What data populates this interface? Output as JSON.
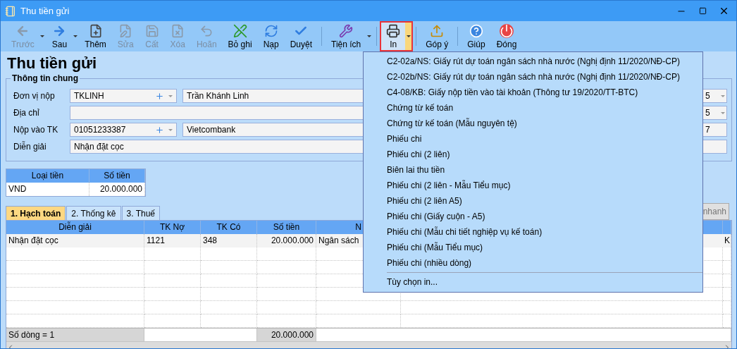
{
  "window": {
    "title": "Thu tiền gửi"
  },
  "toolbar": [
    [
      {
        "label": "Trước",
        "disabled": true,
        "has_menu": true,
        "open": false
      },
      {
        "label": "Sau",
        "disabled": false,
        "has_menu": true,
        "open": false
      },
      {
        "label": "Thêm",
        "disabled": false,
        "has_menu": false,
        "open": false
      },
      {
        "label": "Sửa",
        "disabled": true,
        "has_menu": false,
        "open": false
      },
      {
        "label": "Cất",
        "disabled": true,
        "has_menu": false,
        "open": false
      },
      {
        "label": "Xóa",
        "disabled": true,
        "has_menu": false,
        "open": false
      },
      {
        "label": "Hoãn",
        "disabled": true,
        "has_menu": false,
        "open": false
      },
      {
        "label": "Bỏ ghi",
        "disabled": false,
        "has_menu": false,
        "open": false
      },
      {
        "label": "Nạp",
        "disabled": false,
        "has_menu": false,
        "open": false
      },
      {
        "label": "Duyệt",
        "disabled": false,
        "has_menu": false,
        "open": false
      }
    ],
    [
      {
        "label": "Tiện ích",
        "disabled": false,
        "has_menu": true,
        "open": false
      }
    ],
    [
      {
        "label": "In",
        "disabled": false,
        "has_menu": true,
        "open": true
      }
    ],
    [
      {
        "label": "Góp ý",
        "disabled": false,
        "has_menu": false,
        "open": false
      }
    ],
    [
      {
        "label": "Giúp",
        "disabled": false,
        "has_menu": false,
        "open": false
      },
      {
        "label": "Đóng",
        "disabled": false,
        "has_menu": false,
        "open": false
      }
    ]
  ],
  "heading": "Thu tiền gửi",
  "general_info": {
    "title": "Thông tin chung",
    "fields": [
      {
        "label": "Đơn vị nộp",
        "kind": "lookup",
        "code": "TKLINH",
        "name": "Trần Khánh Linh"
      },
      {
        "label": "Địa chỉ",
        "kind": "text"
      },
      {
        "label": "Nộp vào TK",
        "kind": "lookup",
        "code": "01051233387",
        "name": "Vietcombank"
      },
      {
        "label": "Diễn giải",
        "kind": "text",
        "value": "Nhận đặt cọc"
      }
    ],
    "right_fields": [
      {
        "kind": "combo",
        "value": "5"
      },
      {
        "kind": "combo",
        "value": "5"
      },
      {
        "kind": "text",
        "value": "7"
      },
      {
        "kind": "text"
      }
    ]
  },
  "currency_table": {
    "columns": [
      "Loại tiền",
      "Số tiền"
    ],
    "rows": [
      [
        "VND",
        "20.000.000"
      ]
    ]
  },
  "tabs": [
    {
      "label": "1. Hạch toán",
      "selected": true
    },
    {
      "label": "2. Thống kê",
      "selected": false
    },
    {
      "label": "3. Thuế",
      "selected": false
    }
  ],
  "quick_button": "nhanh",
  "grid": {
    "columns": [
      "Diễn giải",
      "TK Nợ",
      "TK Có",
      "Số tiền",
      "N"
    ],
    "rows": [
      [
        "Nhận đặt cọc",
        "1121",
        "348",
        "20.000.000",
        "Ngân sách",
        "K"
      ]
    ],
    "footer": {
      "count": "Số dòng = 1",
      "total": "20.000.000"
    }
  },
  "print_menu": {
    "items": [
      "C2-02a/NS: Giấy rút dự toán ngân sách nhà nước (Nghị định 11/2020/NĐ-CP)",
      "C2-02b/NS: Giấy rút dự toán ngân sách nhà nước (Nghị định 11/2020/NĐ-CP)",
      "C4-08/KB: Giấy nộp tiền vào tài khoản (Thông tư 19/2020/TT-BTC)",
      "Chứng từ kế toán",
      "Chứng từ kế toán (Mẫu nguyên tệ)",
      "Phiếu chi",
      "Phiếu chi (2 liên)",
      "Biên lai thu tiền",
      "Phiếu chi (2 liên - Mẫu Tiểu mục)",
      "Phiếu chi (2 liên A5)",
      "Phiếu chi (Giấy cuộn - A5)",
      "Phiếu chi (Mẫu chi tiết nghiệp vụ kế toán)",
      "Phiếu chi (Mẫu Tiểu mục)",
      "Phiếu chi (nhiều dòng)"
    ],
    "footer": "Tùy chọn in..."
  }
}
